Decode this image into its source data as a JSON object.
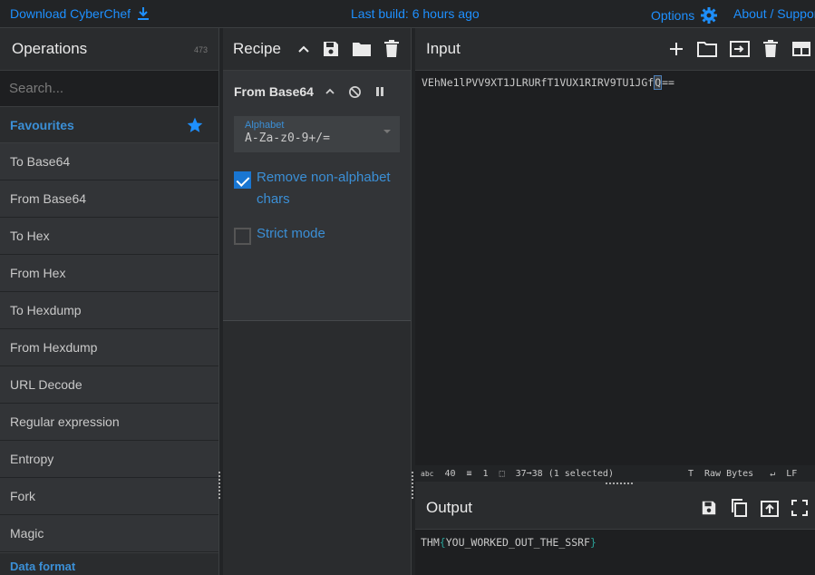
{
  "topbar": {
    "download_label": "Download CyberChef",
    "build_label": "Last build: 6 hours ago",
    "options_label": "Options",
    "about_label": "About / Support"
  },
  "operations": {
    "title": "Operations",
    "count": "473",
    "search_placeholder": "Search...",
    "favourites_label": "Favourites",
    "items": [
      "To Base64",
      "From Base64",
      "To Hex",
      "From Hex",
      "To Hexdump",
      "From Hexdump",
      "URL Decode",
      "Regular expression",
      "Entropy",
      "Fork",
      "Magic"
    ],
    "category_label": "Data format"
  },
  "recipe": {
    "title": "Recipe",
    "operation": {
      "name": "From Base64",
      "alphabet_label": "Alphabet",
      "alphabet_value": "A-Za-z0-9+/=",
      "remove_nonalpha_label": "Remove non-alphabet chars",
      "remove_nonalpha_checked": true,
      "strict_mode_label": "Strict mode",
      "strict_mode_checked": false
    }
  },
  "input": {
    "title": "Input",
    "text_before": "VEhNe1lPVV9XT1JLRURfT1VUX1RIRV9TU1JGf",
    "text_selected": "Q",
    "text_after": "=="
  },
  "status": {
    "length": "40",
    "lines": "1",
    "selection": "37➞38 (1 selected)",
    "raw_bytes_label": "Raw Bytes",
    "line_ending_label": "LF"
  },
  "output": {
    "title": "Output",
    "prefix": "THM",
    "open_brace": "{",
    "inner": "YOU_WORKED_OUT_THE_SSRF",
    "close_brace": "}"
  },
  "colors": {
    "accent": "#1e90ff",
    "background": "#222426",
    "panel": "#2a2c2e"
  }
}
